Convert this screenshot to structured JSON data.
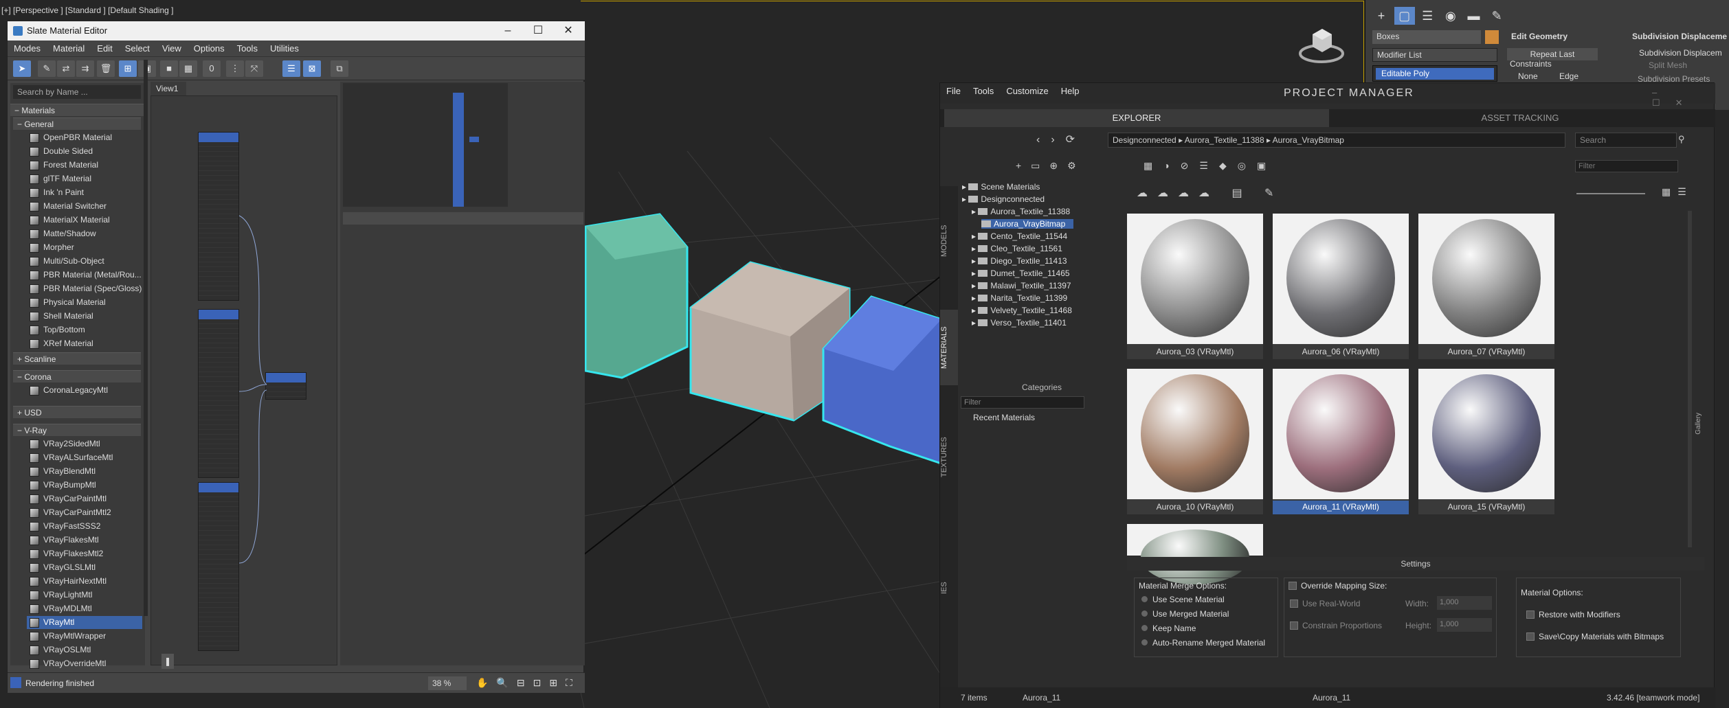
{
  "viewport": {
    "label": "[+] [Perspective ] [Standard ] [Default Shading ]"
  },
  "cmdpanel": {
    "object_name": "Boxes",
    "modifier_list": "Modifier List",
    "stack_item": "Editable Poly",
    "rollout1": "Edit Geometry",
    "repeat_last": "Repeat Last",
    "constraints": "Constraints",
    "opt_none": "None",
    "opt_edge": "Edge",
    "rollout2": "Subdivision Displaceme",
    "subdiv_disp": "Subdivision Displacem",
    "split_mesh": "Split Mesh",
    "subdiv_presets": "Subdivision Presets"
  },
  "slate": {
    "title": "Slate Material Editor",
    "menu": [
      "Modes",
      "Material",
      "Edit",
      "Select",
      "View",
      "Options",
      "Tools",
      "Utilities"
    ],
    "search_placeholder": "Search by Name ...",
    "groups": {
      "materials": "Materials",
      "general": "General",
      "scanline": "Scanline",
      "corona": "Corona",
      "usd": "USD",
      "vray": "V-Ray"
    },
    "general_items": [
      "OpenPBR Material",
      "Double Sided",
      "Forest Material",
      "glTF Material",
      "Ink 'n Paint",
      "Material Switcher",
      "MaterialX Material",
      "Matte/Shadow",
      "Morpher",
      "Multi/Sub-Object",
      "PBR Material (Metal/Rou...",
      "PBR Material (Spec/Gloss)",
      "Physical Material",
      "Shell Material",
      "Top/Bottom",
      "XRef Material"
    ],
    "corona_items": [
      "CoronaLegacyMtl"
    ],
    "vray_items": [
      "VRay2SidedMtl",
      "VRayALSurfaceMtl",
      "VRayBlendMtl",
      "VRayBumpMtl",
      "VRayCarPaintMtl",
      "VRayCarPaintMtl2",
      "VRayFastSSS2",
      "VRayFlakesMtl",
      "VRayFlakesMtl2",
      "VRayGLSLMtl",
      "VRayHairNextMtl",
      "VRayLightMtl",
      "VRayMDLMtl",
      "VRayMtl",
      "VRayMtlWrapper",
      "VRayOSLMtl",
      "VRayOverrideMtl"
    ],
    "view_tab": "View1",
    "status": "Rendering finished",
    "zoom": "38 %"
  },
  "pm": {
    "menu": [
      "File",
      "Tools",
      "Customize",
      "Help"
    ],
    "logo": "PROJECT MANAGER",
    "tabs": {
      "explorer": "EXPLORER",
      "asset": "ASSET TRACKING"
    },
    "breadcrumb": [
      "Designconnected",
      "Aurora_Textile_11388",
      "Aurora_VrayBitmap"
    ],
    "search_placeholder": "Search",
    "filter_placeholder": "Filter",
    "side_tabs": [
      "MODELS",
      "MATERIALS",
      "TEXTURES",
      "IES"
    ],
    "tree": [
      {
        "label": "Scene Materials",
        "level": 0
      },
      {
        "label": "Designconnected",
        "level": 0
      },
      {
        "label": "Aurora_Textile_11388",
        "level": 1
      },
      {
        "label": "Aurora_VrayBitmap",
        "level": 2
      },
      {
        "label": "Cento_Textile_11544",
        "level": 1
      },
      {
        "label": "Cleo_Textile_11561",
        "level": 1
      },
      {
        "label": "Diego_Textile_11413",
        "level": 1
      },
      {
        "label": "Dumet_Textile_11465",
        "level": 1
      },
      {
        "label": "Malawi_Textile_11397",
        "level": 1
      },
      {
        "label": "Narita_Textile_11399",
        "level": 1
      },
      {
        "label": "Velvety_Textile_11468",
        "level": 1
      },
      {
        "label": "Verso_Textile_11401",
        "level": 1
      }
    ],
    "categories": "Categories",
    "cat_filter": "Filter",
    "recent": "Recent Materials",
    "tiles": [
      {
        "name": "Aurora_03 (VRayMtl)",
        "color": "#8a8a8a"
      },
      {
        "name": "Aurora_06 (VRayMtl)",
        "color": "#6e6e72"
      },
      {
        "name": "Aurora_07 (VRayMtl)",
        "color": "#808080"
      },
      {
        "name": "Aurora_10 (VRayMtl)",
        "color": "#a07a62"
      },
      {
        "name": "Aurora_11 (VRayMtl)",
        "color": "#9c6e7c"
      },
      {
        "name": "Aurora_15 (VRayMtl)",
        "color": "#5e5f7e"
      },
      {
        "name": "",
        "color": "#7f8f82"
      }
    ],
    "settings": "Settings",
    "merge_title": "Material Merge Options:",
    "merge_opts": [
      "Use Scene Material",
      "Use Merged Material",
      "Keep Name",
      "Auto-Rename Merged Material"
    ],
    "override": "Override Mapping Size:",
    "use_real_world": "Use Real-World",
    "constrain": "Constrain Proportions",
    "width_lbl": "Width:",
    "height_lbl": "Height:",
    "width_val": "1,000",
    "height_val": "1,000",
    "matopt_title": "Material Options:",
    "restore": "Restore with Modifiers",
    "save_copy": "Save\\Copy Materials with Bitmaps",
    "status_items": "7 items",
    "status_sel": "Aurora_11",
    "status_sel2": "Aurora_11",
    "version": "3.42.46 [teamwork mode]",
    "gallery_label": "Gallery"
  }
}
